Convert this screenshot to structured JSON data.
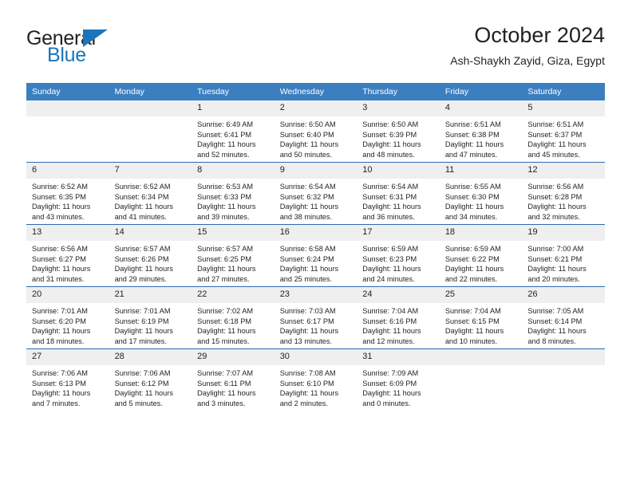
{
  "brand": {
    "name_top": "General",
    "name_bottom": "Blue",
    "accent_color": "#1b75bb",
    "logo_icon": "triangle-flag-icon"
  },
  "header": {
    "title": "October 2024",
    "location": "Ash-Shaykh Zayid, Giza, Egypt"
  },
  "theme": {
    "header_row_bg": "#3c7fc1",
    "week_separator": "#2b6cad",
    "daynum_bg": "#efefef",
    "text_color": "#231f20"
  },
  "calendar": {
    "weekdays": [
      "Sunday",
      "Monday",
      "Tuesday",
      "Wednesday",
      "Thursday",
      "Friday",
      "Saturday"
    ],
    "weeks": [
      [
        {
          "day": "",
          "lines": []
        },
        {
          "day": "",
          "lines": []
        },
        {
          "day": "1",
          "lines": [
            "Sunrise: 6:49 AM",
            "Sunset: 6:41 PM",
            "Daylight: 11 hours",
            "and 52 minutes."
          ]
        },
        {
          "day": "2",
          "lines": [
            "Sunrise: 6:50 AM",
            "Sunset: 6:40 PM",
            "Daylight: 11 hours",
            "and 50 minutes."
          ]
        },
        {
          "day": "3",
          "lines": [
            "Sunrise: 6:50 AM",
            "Sunset: 6:39 PM",
            "Daylight: 11 hours",
            "and 48 minutes."
          ]
        },
        {
          "day": "4",
          "lines": [
            "Sunrise: 6:51 AM",
            "Sunset: 6:38 PM",
            "Daylight: 11 hours",
            "and 47 minutes."
          ]
        },
        {
          "day": "5",
          "lines": [
            "Sunrise: 6:51 AM",
            "Sunset: 6:37 PM",
            "Daylight: 11 hours",
            "and 45 minutes."
          ]
        }
      ],
      [
        {
          "day": "6",
          "lines": [
            "Sunrise: 6:52 AM",
            "Sunset: 6:35 PM",
            "Daylight: 11 hours",
            "and 43 minutes."
          ]
        },
        {
          "day": "7",
          "lines": [
            "Sunrise: 6:52 AM",
            "Sunset: 6:34 PM",
            "Daylight: 11 hours",
            "and 41 minutes."
          ]
        },
        {
          "day": "8",
          "lines": [
            "Sunrise: 6:53 AM",
            "Sunset: 6:33 PM",
            "Daylight: 11 hours",
            "and 39 minutes."
          ]
        },
        {
          "day": "9",
          "lines": [
            "Sunrise: 6:54 AM",
            "Sunset: 6:32 PM",
            "Daylight: 11 hours",
            "and 38 minutes."
          ]
        },
        {
          "day": "10",
          "lines": [
            "Sunrise: 6:54 AM",
            "Sunset: 6:31 PM",
            "Daylight: 11 hours",
            "and 36 minutes."
          ]
        },
        {
          "day": "11",
          "lines": [
            "Sunrise: 6:55 AM",
            "Sunset: 6:30 PM",
            "Daylight: 11 hours",
            "and 34 minutes."
          ]
        },
        {
          "day": "12",
          "lines": [
            "Sunrise: 6:56 AM",
            "Sunset: 6:28 PM",
            "Daylight: 11 hours",
            "and 32 minutes."
          ]
        }
      ],
      [
        {
          "day": "13",
          "lines": [
            "Sunrise: 6:56 AM",
            "Sunset: 6:27 PM",
            "Daylight: 11 hours",
            "and 31 minutes."
          ]
        },
        {
          "day": "14",
          "lines": [
            "Sunrise: 6:57 AM",
            "Sunset: 6:26 PM",
            "Daylight: 11 hours",
            "and 29 minutes."
          ]
        },
        {
          "day": "15",
          "lines": [
            "Sunrise: 6:57 AM",
            "Sunset: 6:25 PM",
            "Daylight: 11 hours",
            "and 27 minutes."
          ]
        },
        {
          "day": "16",
          "lines": [
            "Sunrise: 6:58 AM",
            "Sunset: 6:24 PM",
            "Daylight: 11 hours",
            "and 25 minutes."
          ]
        },
        {
          "day": "17",
          "lines": [
            "Sunrise: 6:59 AM",
            "Sunset: 6:23 PM",
            "Daylight: 11 hours",
            "and 24 minutes."
          ]
        },
        {
          "day": "18",
          "lines": [
            "Sunrise: 6:59 AM",
            "Sunset: 6:22 PM",
            "Daylight: 11 hours",
            "and 22 minutes."
          ]
        },
        {
          "day": "19",
          "lines": [
            "Sunrise: 7:00 AM",
            "Sunset: 6:21 PM",
            "Daylight: 11 hours",
            "and 20 minutes."
          ]
        }
      ],
      [
        {
          "day": "20",
          "lines": [
            "Sunrise: 7:01 AM",
            "Sunset: 6:20 PM",
            "Daylight: 11 hours",
            "and 18 minutes."
          ]
        },
        {
          "day": "21",
          "lines": [
            "Sunrise: 7:01 AM",
            "Sunset: 6:19 PM",
            "Daylight: 11 hours",
            "and 17 minutes."
          ]
        },
        {
          "day": "22",
          "lines": [
            "Sunrise: 7:02 AM",
            "Sunset: 6:18 PM",
            "Daylight: 11 hours",
            "and 15 minutes."
          ]
        },
        {
          "day": "23",
          "lines": [
            "Sunrise: 7:03 AM",
            "Sunset: 6:17 PM",
            "Daylight: 11 hours",
            "and 13 minutes."
          ]
        },
        {
          "day": "24",
          "lines": [
            "Sunrise: 7:04 AM",
            "Sunset: 6:16 PM",
            "Daylight: 11 hours",
            "and 12 minutes."
          ]
        },
        {
          "day": "25",
          "lines": [
            "Sunrise: 7:04 AM",
            "Sunset: 6:15 PM",
            "Daylight: 11 hours",
            "and 10 minutes."
          ]
        },
        {
          "day": "26",
          "lines": [
            "Sunrise: 7:05 AM",
            "Sunset: 6:14 PM",
            "Daylight: 11 hours",
            "and 8 minutes."
          ]
        }
      ],
      [
        {
          "day": "27",
          "lines": [
            "Sunrise: 7:06 AM",
            "Sunset: 6:13 PM",
            "Daylight: 11 hours",
            "and 7 minutes."
          ]
        },
        {
          "day": "28",
          "lines": [
            "Sunrise: 7:06 AM",
            "Sunset: 6:12 PM",
            "Daylight: 11 hours",
            "and 5 minutes."
          ]
        },
        {
          "day": "29",
          "lines": [
            "Sunrise: 7:07 AM",
            "Sunset: 6:11 PM",
            "Daylight: 11 hours",
            "and 3 minutes."
          ]
        },
        {
          "day": "30",
          "lines": [
            "Sunrise: 7:08 AM",
            "Sunset: 6:10 PM",
            "Daylight: 11 hours",
            "and 2 minutes."
          ]
        },
        {
          "day": "31",
          "lines": [
            "Sunrise: 7:09 AM",
            "Sunset: 6:09 PM",
            "Daylight: 11 hours",
            "and 0 minutes."
          ]
        },
        {
          "day": "",
          "lines": []
        },
        {
          "day": "",
          "lines": []
        }
      ]
    ]
  }
}
